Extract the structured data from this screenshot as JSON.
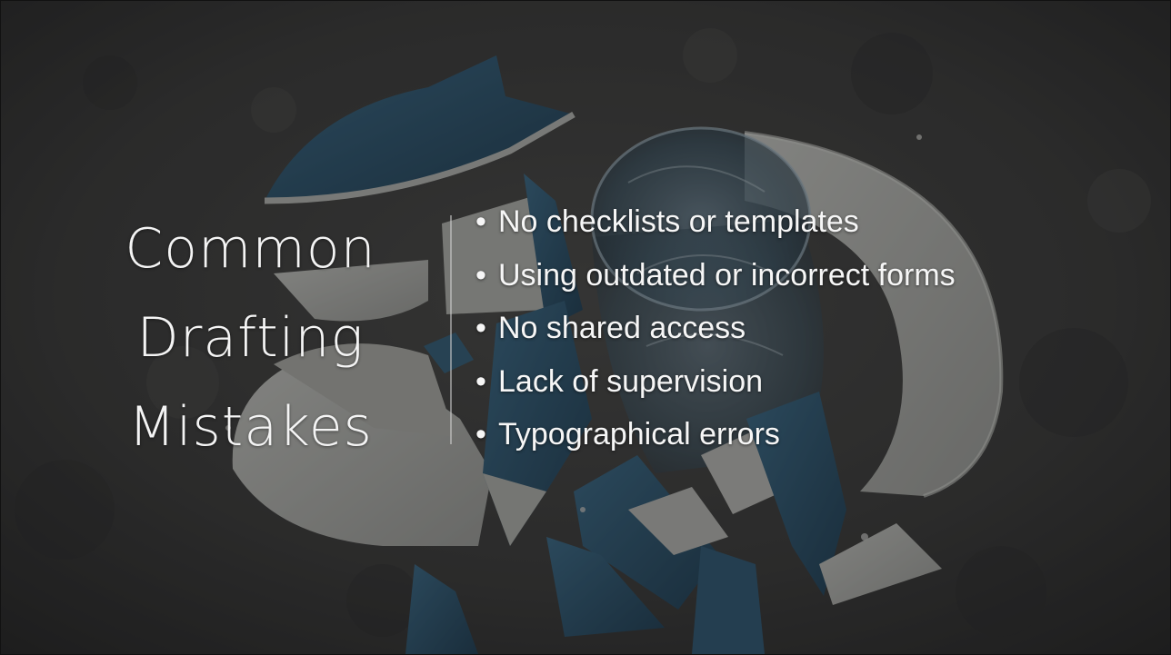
{
  "slide": {
    "title_lines": [
      "Common",
      "Drafting",
      "Mistakes"
    ],
    "bullet_glyph": "•",
    "bullets": [
      "No checklists or templates",
      "Using outdated or incorrect forms",
      "No shared access",
      "Lack of supervision",
      "Typographical errors"
    ]
  },
  "background": {
    "description_icon": "broken-plates-and-glass-photo-icon",
    "floor_color": "#3c3c3a",
    "plate_white": "#b9bab4",
    "plate_blue": "#2e5670"
  }
}
